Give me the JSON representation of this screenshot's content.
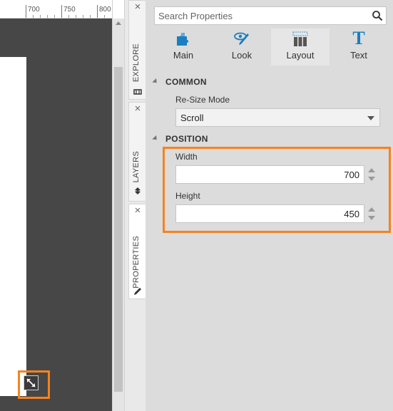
{
  "ruler": {
    "labels": [
      "700",
      "750",
      "800"
    ]
  },
  "tabs": {
    "explore": {
      "label": "EXPLORE",
      "close": "×"
    },
    "layers": {
      "label": "LAYERS",
      "close": "×"
    },
    "properties": {
      "label": "PROPERTIES",
      "close": "×"
    }
  },
  "search": {
    "placeholder": "Search Properties"
  },
  "categories": [
    {
      "label": "Main",
      "icon": "puzzle-icon"
    },
    {
      "label": "Look",
      "icon": "eye-brush-icon"
    },
    {
      "label": "Layout",
      "icon": "layout-columns-icon",
      "active": true
    },
    {
      "label": "Text",
      "icon": "text-t-icon",
      "glyph": "T"
    }
  ],
  "common": {
    "title": "COMMON",
    "resize_mode_label": "Re-Size Mode",
    "resize_mode_value": "Scroll"
  },
  "position": {
    "title": "POSITION",
    "width_label": "Width",
    "width_value": "700",
    "height_label": "Height",
    "height_value": "450"
  },
  "colors": {
    "highlight": "#f5821f",
    "canvas": "#474747",
    "panel": "#dcdcdc",
    "accent_blue": "#1a7fc1"
  }
}
